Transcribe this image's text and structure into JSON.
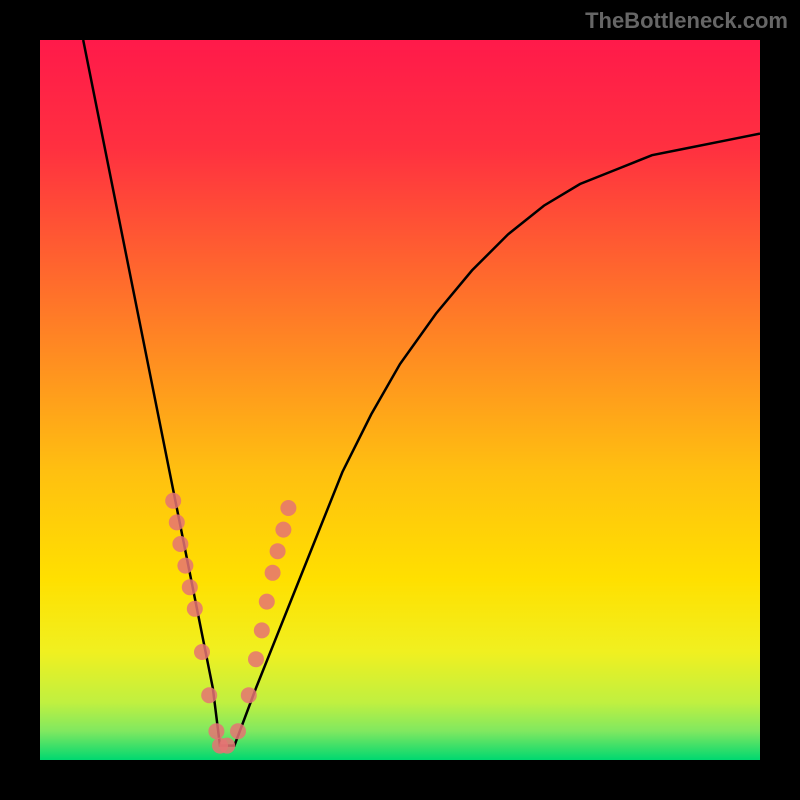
{
  "watermark": "TheBottleneck.com",
  "chart_data": {
    "type": "line",
    "title": "",
    "xlabel": "",
    "ylabel": "",
    "xlim": [
      0,
      100
    ],
    "ylim": [
      0,
      100
    ],
    "series": [
      {
        "name": "bottleneck-curve",
        "x": [
          6,
          8,
          10,
          12,
          14,
          16,
          18,
          20,
          22,
          24,
          25,
          27,
          30,
          34,
          38,
          42,
          46,
          50,
          55,
          60,
          65,
          70,
          75,
          80,
          85,
          90,
          95,
          100
        ],
        "y": [
          100,
          90,
          80,
          70,
          60,
          50,
          40,
          30,
          20,
          10,
          2,
          2,
          10,
          20,
          30,
          40,
          48,
          55,
          62,
          68,
          73,
          77,
          80,
          82,
          84,
          85,
          86,
          87
        ]
      }
    ],
    "marker_points": {
      "name": "data-markers",
      "x": [
        18.5,
        19,
        19.5,
        20.2,
        20.8,
        21.5,
        22.5,
        23.5,
        24.5,
        25,
        26,
        27.5,
        29,
        30,
        30.8,
        31.5,
        32.3,
        33,
        33.8,
        34.5
      ],
      "y": [
        36,
        33,
        30,
        27,
        24,
        21,
        15,
        9,
        4,
        2,
        2,
        4,
        9,
        14,
        18,
        22,
        26,
        29,
        32,
        35
      ]
    },
    "gradient_colors": {
      "top": "#ff1744",
      "mid_upper": "#ff5722",
      "mid": "#ffc107",
      "mid_lower": "#ffeb3b",
      "lower": "#cddc39",
      "bottom": "#00e676"
    },
    "marker_color": "#e57373",
    "curve_color": "#000000"
  }
}
